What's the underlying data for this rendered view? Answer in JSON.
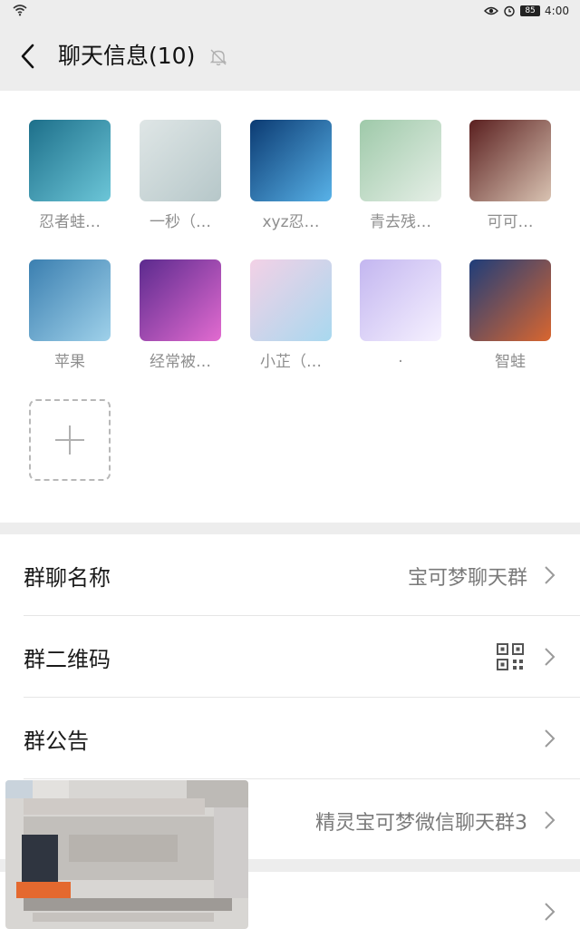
{
  "status_bar": {
    "time": "4:00",
    "battery": "85"
  },
  "nav": {
    "title": "聊天信息(10)"
  },
  "members": [
    {
      "name": "忍者蛙…",
      "colors": [
        "#1d6f8a",
        "#6cc6d8"
      ]
    },
    {
      "name": "一秒（…",
      "colors": [
        "#dfe6e6",
        "#b6c7c9"
      ]
    },
    {
      "name": "xyz忍…",
      "colors": [
        "#0b3a72",
        "#58b2e8"
      ]
    },
    {
      "name": "青去残…",
      "colors": [
        "#9ec9a9",
        "#e6efe7"
      ]
    },
    {
      "name": "可可…",
      "colors": [
        "#5a1f1f",
        "#d9c3b2"
      ]
    },
    {
      "name": "苹果",
      "colors": [
        "#3b7fb0",
        "#9fd1ea"
      ]
    },
    {
      "name": "经常被…",
      "colors": [
        "#5b2a8e",
        "#e26bd0"
      ]
    },
    {
      "name": "小芷（…",
      "colors": [
        "#f3d1e6",
        "#a8d8ef"
      ]
    },
    {
      "name": ".",
      "colors": [
        "#c3b6f0",
        "#f6f1ff"
      ]
    },
    {
      "name": "智蛙",
      "colors": [
        "#1e3d7a",
        "#d9662f"
      ]
    }
  ],
  "settings": [
    {
      "label": "群聊名称",
      "value": "宝可梦聊天群"
    },
    {
      "label": "群二维码",
      "value": ""
    },
    {
      "label": "群公告",
      "value": ""
    },
    {
      "label": "",
      "value": "精灵宝可梦微信聊天群3"
    }
  ]
}
